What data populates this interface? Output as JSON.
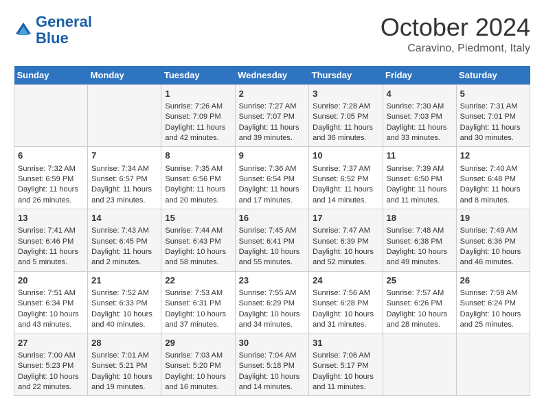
{
  "header": {
    "logo_general": "General",
    "logo_blue": "Blue",
    "month_title": "October 2024",
    "location": "Caravino, Piedmont, Italy"
  },
  "weekdays": [
    "Sunday",
    "Monday",
    "Tuesday",
    "Wednesday",
    "Thursday",
    "Friday",
    "Saturday"
  ],
  "weeks": [
    [
      {
        "day": "",
        "info": ""
      },
      {
        "day": "",
        "info": ""
      },
      {
        "day": "1",
        "info": "Sunrise: 7:26 AM\nSunset: 7:09 PM\nDaylight: 11 hours and 42 minutes."
      },
      {
        "day": "2",
        "info": "Sunrise: 7:27 AM\nSunset: 7:07 PM\nDaylight: 11 hours and 39 minutes."
      },
      {
        "day": "3",
        "info": "Sunrise: 7:28 AM\nSunset: 7:05 PM\nDaylight: 11 hours and 36 minutes."
      },
      {
        "day": "4",
        "info": "Sunrise: 7:30 AM\nSunset: 7:03 PM\nDaylight: 11 hours and 33 minutes."
      },
      {
        "day": "5",
        "info": "Sunrise: 7:31 AM\nSunset: 7:01 PM\nDaylight: 11 hours and 30 minutes."
      }
    ],
    [
      {
        "day": "6",
        "info": "Sunrise: 7:32 AM\nSunset: 6:59 PM\nDaylight: 11 hours and 26 minutes."
      },
      {
        "day": "7",
        "info": "Sunrise: 7:34 AM\nSunset: 6:57 PM\nDaylight: 11 hours and 23 minutes."
      },
      {
        "day": "8",
        "info": "Sunrise: 7:35 AM\nSunset: 6:56 PM\nDaylight: 11 hours and 20 minutes."
      },
      {
        "day": "9",
        "info": "Sunrise: 7:36 AM\nSunset: 6:54 PM\nDaylight: 11 hours and 17 minutes."
      },
      {
        "day": "10",
        "info": "Sunrise: 7:37 AM\nSunset: 6:52 PM\nDaylight: 11 hours and 14 minutes."
      },
      {
        "day": "11",
        "info": "Sunrise: 7:39 AM\nSunset: 6:50 PM\nDaylight: 11 hours and 11 minutes."
      },
      {
        "day": "12",
        "info": "Sunrise: 7:40 AM\nSunset: 6:48 PM\nDaylight: 11 hours and 8 minutes."
      }
    ],
    [
      {
        "day": "13",
        "info": "Sunrise: 7:41 AM\nSunset: 6:46 PM\nDaylight: 11 hours and 5 minutes."
      },
      {
        "day": "14",
        "info": "Sunrise: 7:43 AM\nSunset: 6:45 PM\nDaylight: 11 hours and 2 minutes."
      },
      {
        "day": "15",
        "info": "Sunrise: 7:44 AM\nSunset: 6:43 PM\nDaylight: 10 hours and 58 minutes."
      },
      {
        "day": "16",
        "info": "Sunrise: 7:45 AM\nSunset: 6:41 PM\nDaylight: 10 hours and 55 minutes."
      },
      {
        "day": "17",
        "info": "Sunrise: 7:47 AM\nSunset: 6:39 PM\nDaylight: 10 hours and 52 minutes."
      },
      {
        "day": "18",
        "info": "Sunrise: 7:48 AM\nSunset: 6:38 PM\nDaylight: 10 hours and 49 minutes."
      },
      {
        "day": "19",
        "info": "Sunrise: 7:49 AM\nSunset: 6:36 PM\nDaylight: 10 hours and 46 minutes."
      }
    ],
    [
      {
        "day": "20",
        "info": "Sunrise: 7:51 AM\nSunset: 6:34 PM\nDaylight: 10 hours and 43 minutes."
      },
      {
        "day": "21",
        "info": "Sunrise: 7:52 AM\nSunset: 6:33 PM\nDaylight: 10 hours and 40 minutes."
      },
      {
        "day": "22",
        "info": "Sunrise: 7:53 AM\nSunset: 6:31 PM\nDaylight: 10 hours and 37 minutes."
      },
      {
        "day": "23",
        "info": "Sunrise: 7:55 AM\nSunset: 6:29 PM\nDaylight: 10 hours and 34 minutes."
      },
      {
        "day": "24",
        "info": "Sunrise: 7:56 AM\nSunset: 6:28 PM\nDaylight: 10 hours and 31 minutes."
      },
      {
        "day": "25",
        "info": "Sunrise: 7:57 AM\nSunset: 6:26 PM\nDaylight: 10 hours and 28 minutes."
      },
      {
        "day": "26",
        "info": "Sunrise: 7:59 AM\nSunset: 6:24 PM\nDaylight: 10 hours and 25 minutes."
      }
    ],
    [
      {
        "day": "27",
        "info": "Sunrise: 7:00 AM\nSunset: 5:23 PM\nDaylight: 10 hours and 22 minutes."
      },
      {
        "day": "28",
        "info": "Sunrise: 7:01 AM\nSunset: 5:21 PM\nDaylight: 10 hours and 19 minutes."
      },
      {
        "day": "29",
        "info": "Sunrise: 7:03 AM\nSunset: 5:20 PM\nDaylight: 10 hours and 16 minutes."
      },
      {
        "day": "30",
        "info": "Sunrise: 7:04 AM\nSunset: 5:18 PM\nDaylight: 10 hours and 14 minutes."
      },
      {
        "day": "31",
        "info": "Sunrise: 7:06 AM\nSunset: 5:17 PM\nDaylight: 10 hours and 11 minutes."
      },
      {
        "day": "",
        "info": ""
      },
      {
        "day": "",
        "info": ""
      }
    ]
  ]
}
